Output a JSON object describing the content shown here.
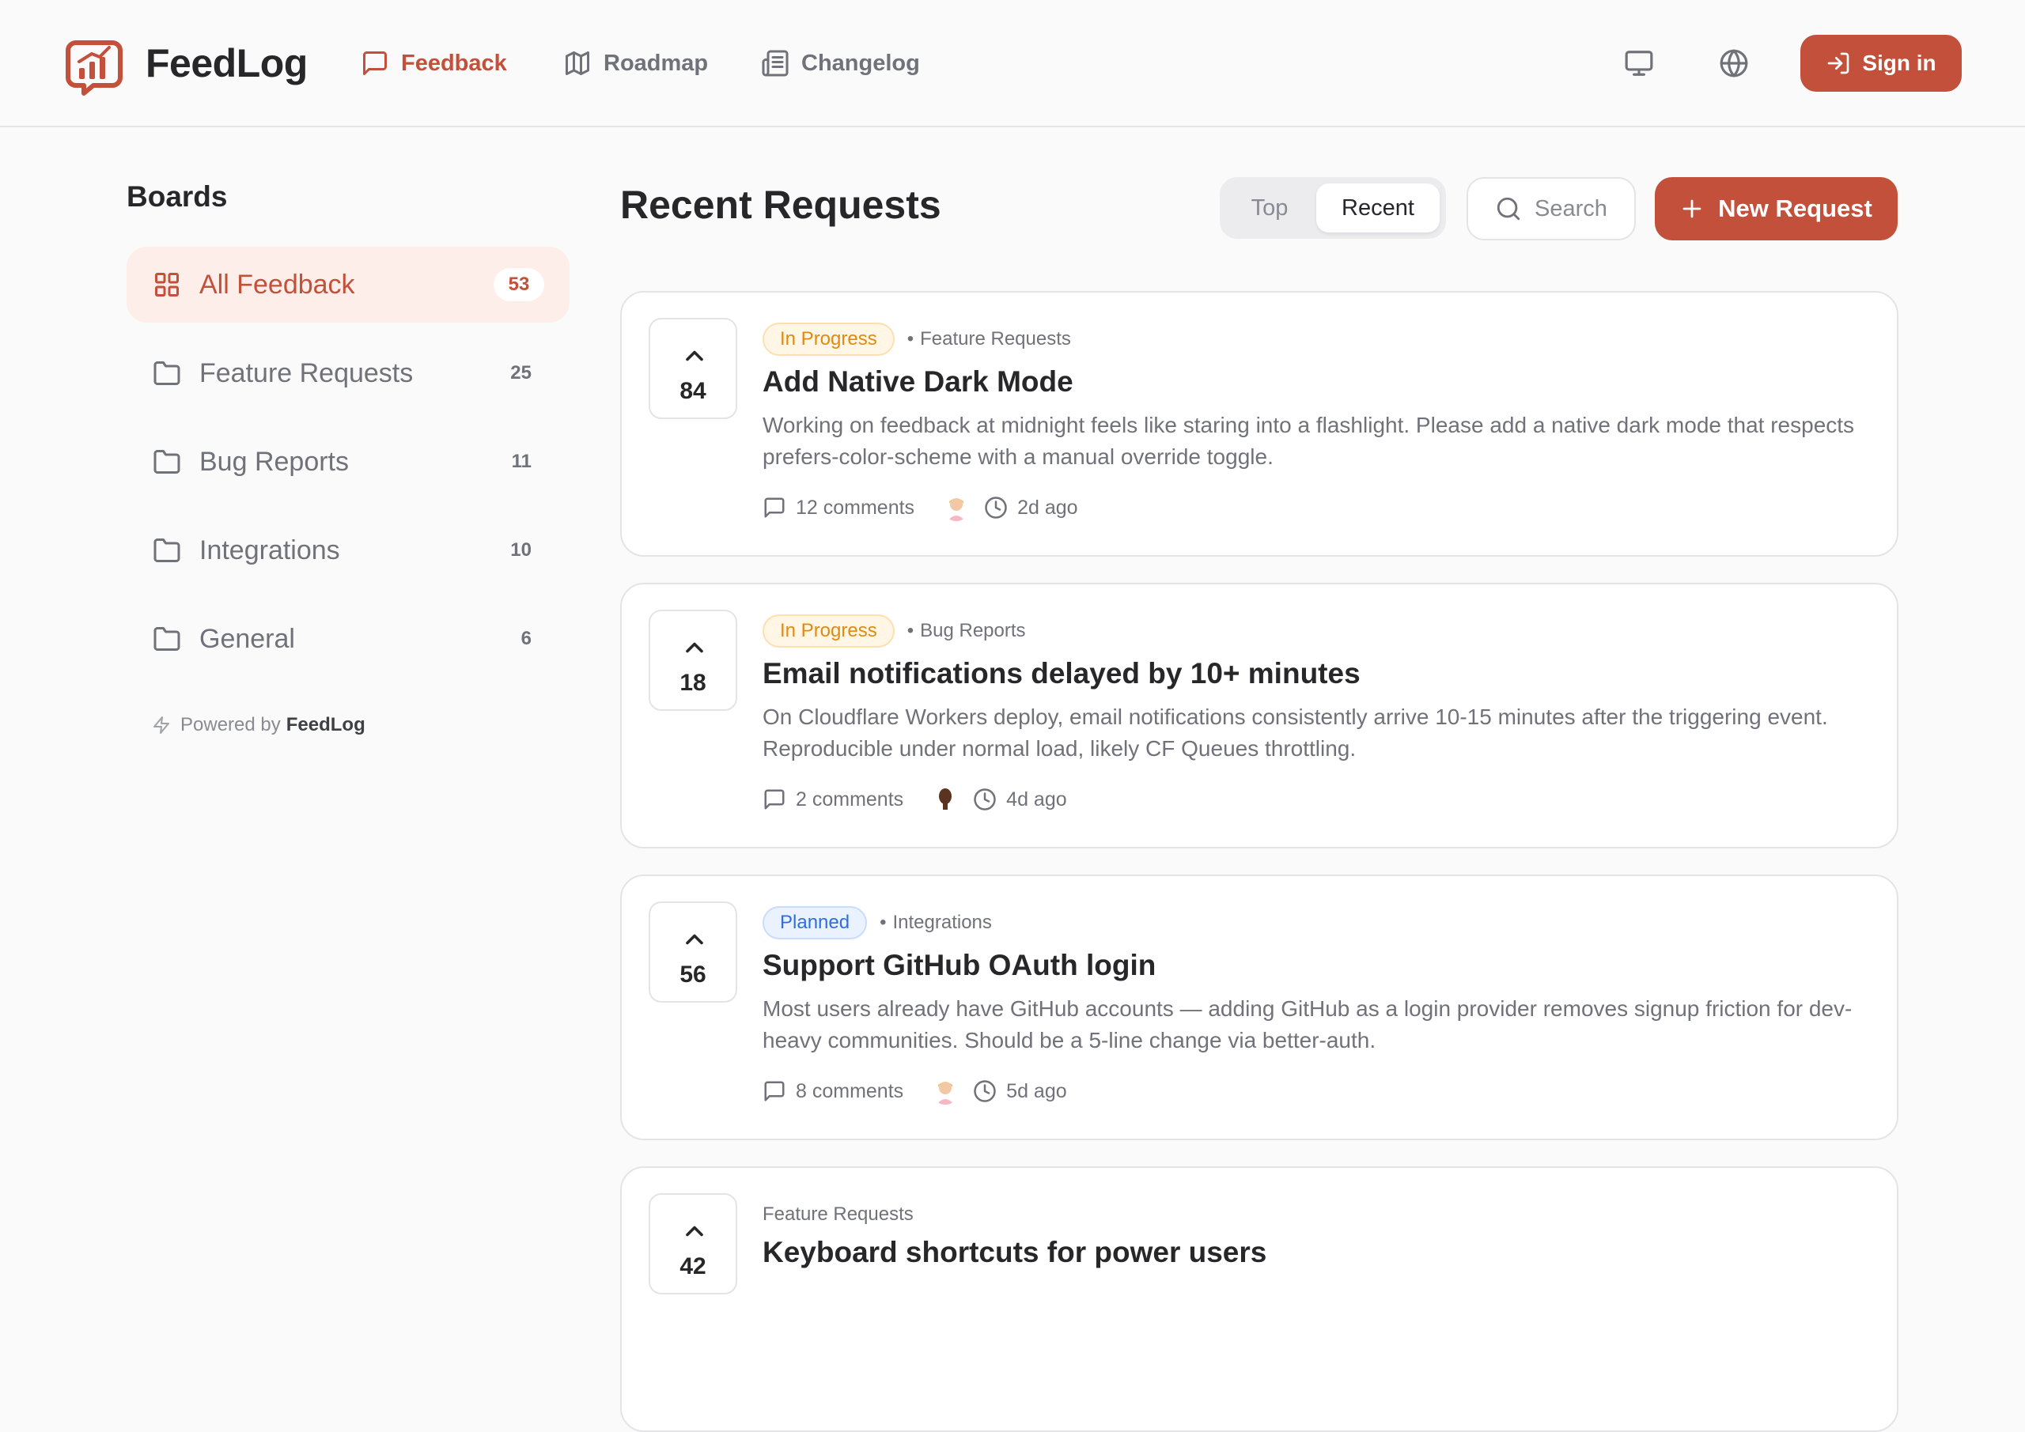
{
  "app": {
    "name": "FeedLog",
    "brand_color": "#c2503a"
  },
  "nav": {
    "items": [
      {
        "label": "Feedback",
        "icon": "message-square-icon",
        "active": true
      },
      {
        "label": "Roadmap",
        "icon": "map-icon",
        "active": false
      },
      {
        "label": "Changelog",
        "icon": "newspaper-icon",
        "active": false
      }
    ],
    "display_icon": "monitor-icon",
    "language_icon": "globe-icon",
    "signin_label": "Sign in"
  },
  "sidebar": {
    "title": "Boards",
    "items": [
      {
        "label": "All Feedback",
        "count": "53",
        "icon": "grid-icon",
        "active": true
      },
      {
        "label": "Feature Requests",
        "count": "25",
        "icon": "folder-icon"
      },
      {
        "label": "Bug Reports",
        "count": "11",
        "icon": "folder-icon"
      },
      {
        "label": "Integrations",
        "count": "10",
        "icon": "folder-icon"
      },
      {
        "label": "General",
        "count": "6",
        "icon": "folder-icon"
      }
    ],
    "powered_prefix": "Powered by",
    "powered_brand": "FeedLog"
  },
  "main": {
    "title": "Recent Requests",
    "sort_options": [
      "Top",
      "Recent"
    ],
    "sort_selected": "Recent",
    "search_label": "Search",
    "new_request_label": "New Request"
  },
  "requests": [
    {
      "votes": "84",
      "status": "In Progress",
      "status_kind": "progress",
      "board": "Feature Requests",
      "title": "Add Native Dark Mode",
      "description": "Working on feedback at midnight feels like staring into a flashlight. Please add a native dark mode that respects prefers-color-scheme with a manual override toggle.",
      "comments": "12 comments",
      "time": "2d ago"
    },
    {
      "votes": "18",
      "status": "In Progress",
      "status_kind": "progress",
      "board": "Bug Reports",
      "title": "Email notifications delayed by 10+ minutes",
      "description": "On Cloudflare Workers deploy, email notifications consistently arrive 10-15 minutes after the triggering event. Reproducible under normal load, likely CF Queues throttling.",
      "comments": "2 comments",
      "time": "4d ago"
    },
    {
      "votes": "56",
      "status": "Planned",
      "status_kind": "planned",
      "board": "Integrations",
      "title": "Support GitHub OAuth login",
      "description": "Most users already have GitHub accounts — adding GitHub as a login provider removes signup friction for dev-heavy communities. Should be a 5-line change via better-auth.",
      "comments": "8 comments",
      "time": "5d ago"
    },
    {
      "votes": "42",
      "board": "Feature Requests",
      "title": "Keyboard shortcuts for power users"
    }
  ]
}
